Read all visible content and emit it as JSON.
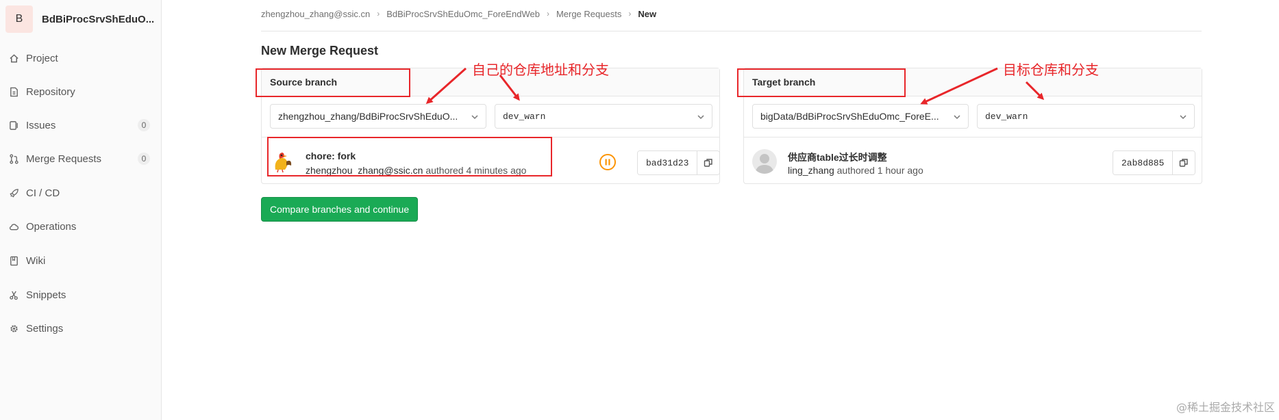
{
  "project": {
    "avatar_letter": "B",
    "name": "BdBiProcSrvShEduO..."
  },
  "sidebar": {
    "items": [
      {
        "label": "Project",
        "icon": "home-icon"
      },
      {
        "label": "Repository",
        "icon": "doc-icon"
      },
      {
        "label": "Issues",
        "icon": "issues-icon",
        "badge": "0"
      },
      {
        "label": "Merge Requests",
        "icon": "merge-icon",
        "badge": "0"
      },
      {
        "label": "CI / CD",
        "icon": "rocket-icon"
      },
      {
        "label": "Operations",
        "icon": "cloud-icon"
      },
      {
        "label": "Wiki",
        "icon": "book-icon"
      },
      {
        "label": "Snippets",
        "icon": "scissors-icon"
      },
      {
        "label": "Settings",
        "icon": "gear-icon"
      }
    ]
  },
  "breadcrumb": [
    "zhengzhou_zhang@ssic.cn",
    "BdBiProcSrvShEduOmc_ForeEndWeb",
    "Merge Requests",
    "New"
  ],
  "page_title": "New Merge Request",
  "source": {
    "header": "Source branch",
    "project": "zhengzhou_zhang/BdBiProcSrvShEduO...",
    "branch": "dev_warn",
    "commit": {
      "title": "chore: fork",
      "author": "zhengzhou_zhang@ssic.cn",
      "time": "authored 4 minutes ago",
      "sha": "bad31d23"
    }
  },
  "target": {
    "header": "Target branch",
    "project": "bigData/BdBiProcSrvShEduOmc_ForeE...",
    "branch": "dev_warn",
    "commit": {
      "title": "供应商table过长时调整",
      "author": "ling_zhang",
      "time": "authored 1 hour ago",
      "sha": "2ab8d885"
    }
  },
  "compare_button": "Compare branches and continue",
  "annotations": {
    "source_note": "自己的仓库地址和分支",
    "target_note": "目标仓库和分支",
    "color": "#e8262a"
  },
  "watermark": "@稀土掘金技术社区",
  "colors": {
    "primary_button": "#1aaa55",
    "pipeline_paused": "#fc9403"
  }
}
